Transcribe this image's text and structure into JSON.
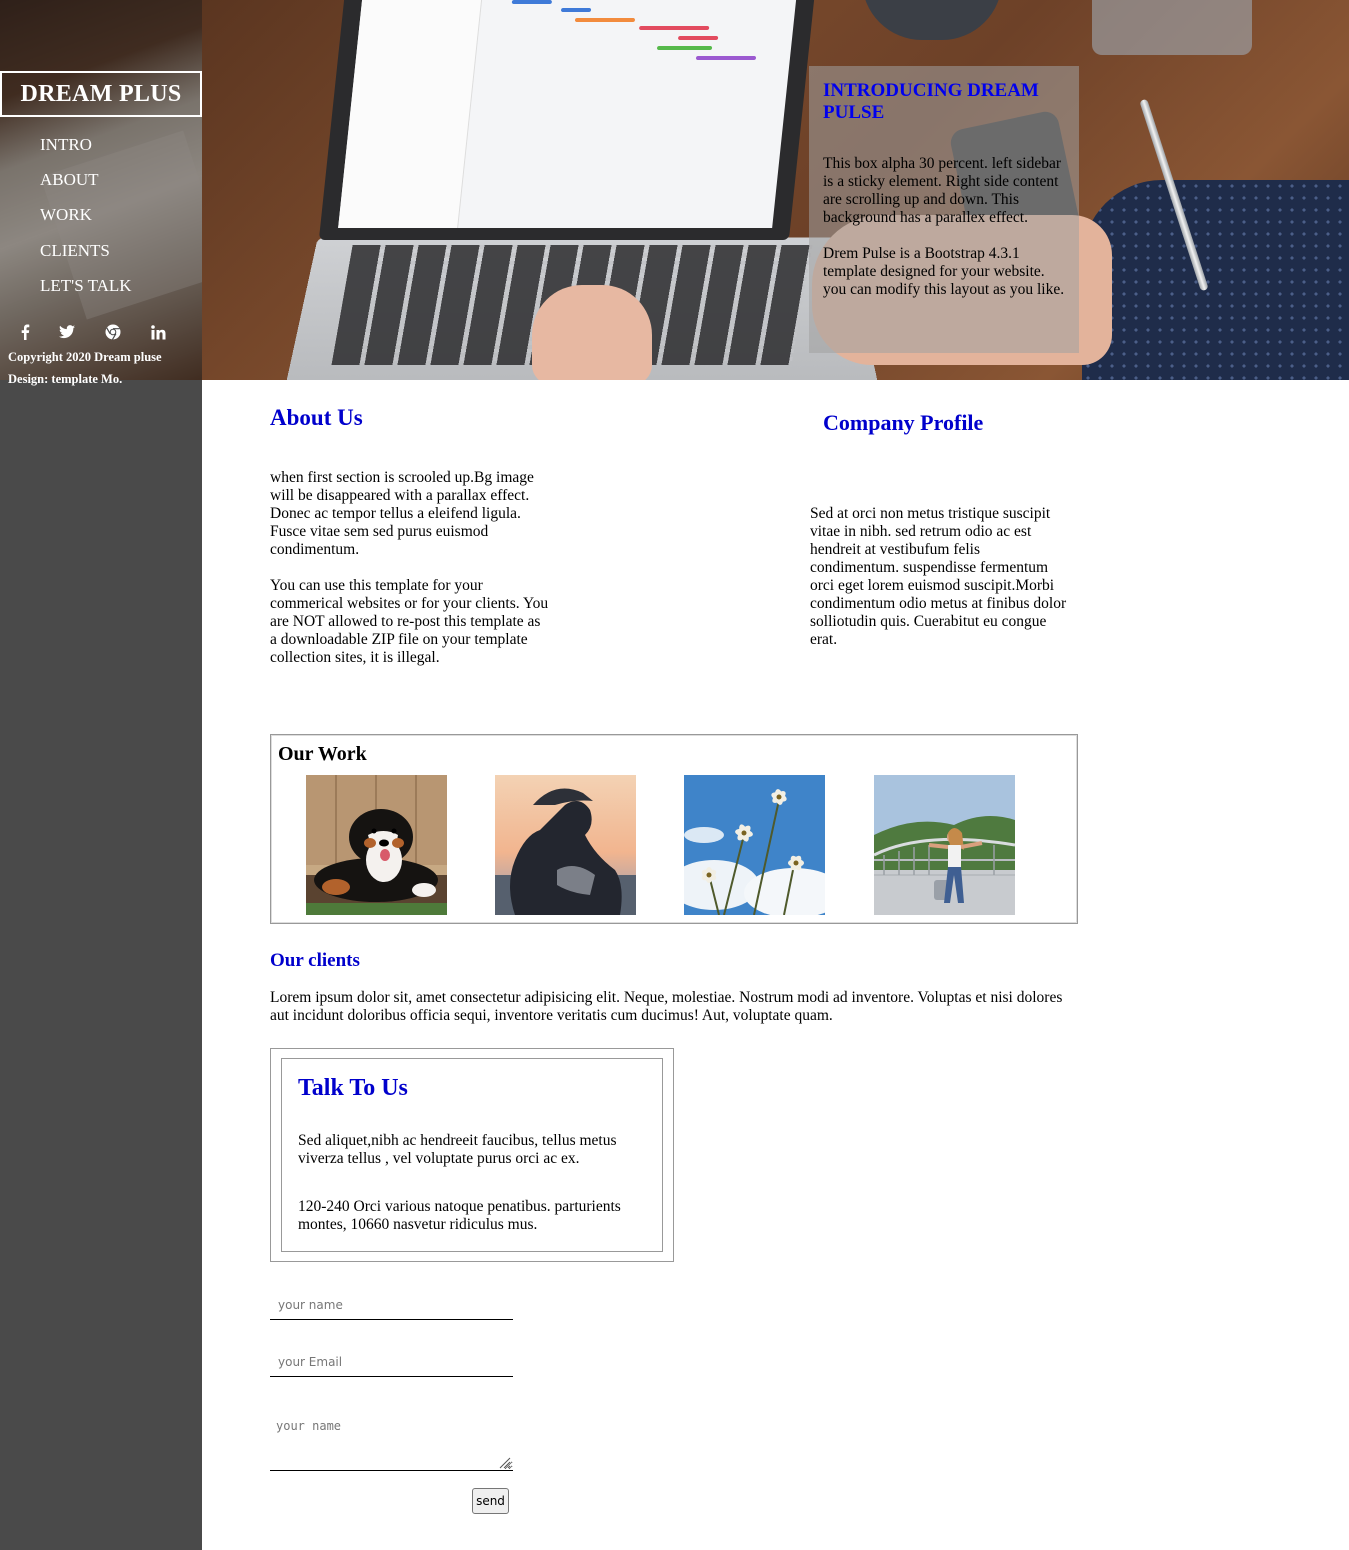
{
  "sidebar": {
    "brand": "DREAM PLUS",
    "nav": [
      {
        "label": "INTRO"
      },
      {
        "label": "ABOUT"
      },
      {
        "label": "WORK"
      },
      {
        "label": "CLIENTS"
      },
      {
        "label": "LET'S TALK"
      }
    ],
    "social_icons": [
      "facebook-icon",
      "twitter-icon",
      "chrome-icon",
      "linkedin-icon"
    ],
    "copyright": "Copyright 2020 Dream pluse",
    "design": "Design: template Mo."
  },
  "intro": {
    "title": "INTRODUCING DREAM PULSE",
    "paragraph1": "This box alpha 30 percent. left sidebar is a sticky element. Right side content are scrolling up and down. This background has a parallex effect.",
    "paragraph2": "Drem Pulse is a Bootstrap 4.3.1 template designed for your website. you can modify this layout as you like."
  },
  "about": {
    "title": "About Us",
    "paragraph1": "when first section is scrooled up.Bg image will be disappeared with a parallax effect. Donec ac tempor tellus a eleifend ligula. Fusce vitae sem sed purus euismod condimentum.",
    "paragraph2": "You can use this template for your commerical websites or for your clients. You are NOT allowed to re-post this template as a downloadable ZIP file on your template collection sites, it is illegal."
  },
  "profile": {
    "title": "Company Profile",
    "text": "Sed at orci non metus tristique suscipit vitae in nibh. sed retrum odio ac est hendreit at vestibufum felis condimentum. suspendisse fermentum orci eget lorem euismod suscipit.Morbi condimentum odio metus at finibus dolor solliotudin quis. Cuerabitut eu congue erat."
  },
  "work": {
    "title": "Our Work"
  },
  "clients": {
    "title": "Our clients",
    "text": "Lorem ipsum dolor sit, amet consectetur adipisicing elit. Neque, molestiae. Nostrum modi ad inventore. Voluptas et nisi dolores aut incidunt doloribus officia sequi, inventore veritatis cum ducimus! Aut, voluptate quam."
  },
  "talk": {
    "title": "Talk To Us",
    "paragraph1": "Sed aliquet,nibh ac hendreeit faucibus, tellus metus viverza tellus , vel voluptate purus orci ac ex.",
    "paragraph2": "120-240 Orci various natoque penatibus. parturients montes, 10660 nasvetur ridiculus mus."
  },
  "form": {
    "name_placeholder": "your name",
    "email_placeholder": "your Email",
    "message_placeholder": "your name",
    "send_label": "send"
  },
  "colors": {
    "sidebar_bg": "#4a4a4a",
    "heading_blue": "#0000cc"
  }
}
